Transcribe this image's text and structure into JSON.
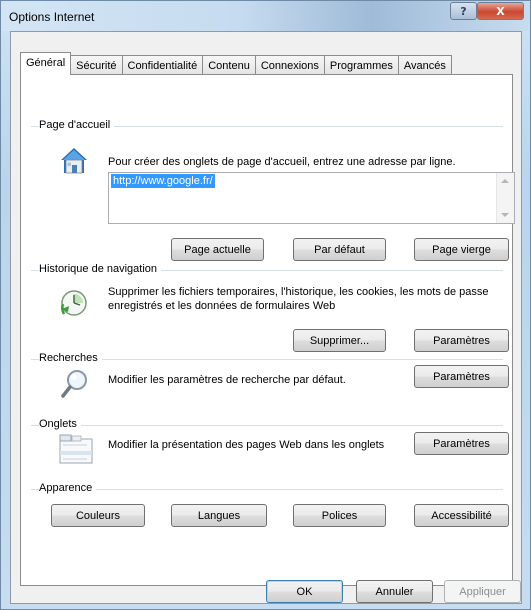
{
  "window": {
    "title": "Options Internet",
    "help_label": "?",
    "close_label": "X"
  },
  "tabs": [
    {
      "label": "Général"
    },
    {
      "label": "Sécurité"
    },
    {
      "label": "Confidentialité"
    },
    {
      "label": "Contenu"
    },
    {
      "label": "Connexions"
    },
    {
      "label": "Programmes"
    },
    {
      "label": "Avancés"
    }
  ],
  "homepage": {
    "group": "Page d'accueil",
    "description": "Pour créer des onglets de page d'accueil, entrez une adresse par ligne.",
    "url": "http://www.google.fr/",
    "buttons": {
      "current": "Page actuelle",
      "default": "Par défaut",
      "blank": "Page vierge"
    }
  },
  "history": {
    "group": "Historique de navigation",
    "description_line1": "Supprimer les fichiers temporaires, l'historique, les cookies, les mots de passe",
    "description_line2": "enregistrés et les données de formulaires Web",
    "buttons": {
      "delete": "Supprimer...",
      "settings": "Paramètres"
    }
  },
  "search": {
    "group": "Recherches",
    "description": "Modifier les paramètres de recherche par défaut.",
    "buttons": {
      "settings": "Paramètres"
    }
  },
  "tabs_section": {
    "group": "Onglets",
    "description": "Modifier la présentation des pages Web dans les onglets",
    "buttons": {
      "settings": "Paramètres"
    }
  },
  "appearance": {
    "group": "Apparence",
    "buttons": {
      "colors": "Couleurs",
      "languages": "Langues",
      "fonts": "Polices",
      "accessibility": "Accessibilité"
    }
  },
  "footer": {
    "ok": "OK",
    "cancel": "Annuler",
    "apply": "Appliquer"
  }
}
